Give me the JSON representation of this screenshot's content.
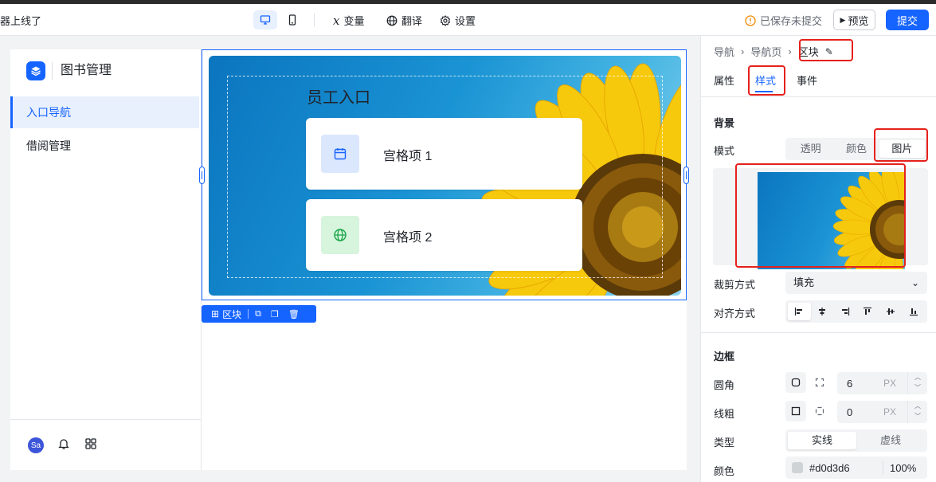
{
  "topbar": {
    "crumb": "器上线了",
    "variables": "变量",
    "translate": "翻译",
    "settings": "设置",
    "status": "已保存未提交",
    "preview": "预览",
    "submit": "提交"
  },
  "app": {
    "title": "图书管理",
    "nav": [
      {
        "label": "入口导航",
        "active": true
      },
      {
        "label": "借阅管理",
        "active": false
      }
    ],
    "avatar": "Sa"
  },
  "hero": {
    "title": "员工入口",
    "cards": [
      {
        "label": "宫格项 1",
        "icon": "calendar-icon",
        "bg": "#dbe7fd",
        "color": "#1664ff"
      },
      {
        "label": "宫格项 2",
        "icon": "globe-icon",
        "bg": "#d6f5dc",
        "color": "#1aa34a"
      }
    ]
  },
  "block_toolbar": {
    "label": "区块"
  },
  "panel": {
    "breadcrumb": [
      "导航",
      "导航页",
      "区块"
    ],
    "tabs": [
      {
        "label": "属性",
        "active": false
      },
      {
        "label": "样式",
        "active": true
      },
      {
        "label": "事件",
        "active": false
      }
    ],
    "background": {
      "title": "背景",
      "mode_label": "模式",
      "modes": [
        {
          "label": "透明",
          "active": false
        },
        {
          "label": "颜色",
          "active": false
        },
        {
          "label": "图片",
          "active": true
        }
      ],
      "crop_label": "裁剪方式",
      "crop_value": "填充",
      "align_label": "对齐方式"
    },
    "border": {
      "title": "边框",
      "radius_label": "圆角",
      "radius_value": "6",
      "width_label": "线粗",
      "width_value": "0",
      "unit": "PX",
      "type_label": "类型",
      "types": [
        {
          "label": "实线",
          "active": true
        },
        {
          "label": "虚线",
          "active": false
        }
      ],
      "color_label": "颜色",
      "color_value": "#d0d3d6",
      "opacity": "100%"
    }
  },
  "colors": {
    "accent": "#1664ff",
    "highlight": "#e5211c"
  }
}
